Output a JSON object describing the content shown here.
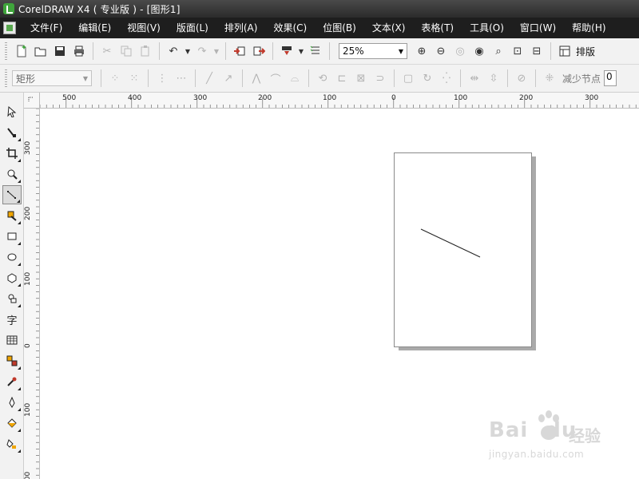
{
  "window": {
    "title": "CorelDRAW X4 ( 专业版 ) - [图形1]"
  },
  "menubar": {
    "items": [
      "文件(F)",
      "编辑(E)",
      "视图(V)",
      "版面(L)",
      "排列(A)",
      "效果(C)",
      "位图(B)",
      "文本(X)",
      "表格(T)",
      "工具(O)",
      "窗口(W)",
      "帮助(H)"
    ]
  },
  "toolbar": {
    "zoom_level": "25%",
    "layout_label": "排版"
  },
  "property_bar": {
    "shape_select": "矩形",
    "reduce_nodes_label": "减少节点",
    "reduce_nodes_value": "0"
  },
  "ruler_h": {
    "labels": [
      "500",
      "400",
      "300",
      "200",
      "100",
      "0",
      "100",
      "200",
      "300"
    ]
  },
  "ruler_v": {
    "labels": [
      "300",
      "200",
      "100",
      "0",
      "100",
      "200"
    ]
  },
  "toolbox": {
    "icons": [
      "pick-tool-icon",
      "shape-tool-icon",
      "crop-tool-icon",
      "zoom-tool-icon",
      "freehand-tool-icon",
      "smart-fill-tool-icon",
      "rectangle-tool-icon",
      "ellipse-tool-icon",
      "polygon-tool-icon",
      "basic-shapes-tool-icon",
      "text-tool-icon",
      "table-tool-icon",
      "interactive-blend-tool-icon",
      "eyedropper-tool-icon",
      "outline-tool-icon",
      "fill-tool-icon",
      "interactive-fill-tool-icon"
    ],
    "text_tool_glyph": "字"
  },
  "watermark": {
    "brand": "Bai",
    "brand2": "du",
    "jingyan": "经验",
    "url": "jingyan.baidu.com"
  },
  "colors": {
    "titlebar": "#2b2b2b",
    "menubar": "#1e1e1e",
    "toolbar": "#f2f2f2",
    "page_shadow": "#aaaaaa",
    "app_icon": "#3fa53b"
  }
}
